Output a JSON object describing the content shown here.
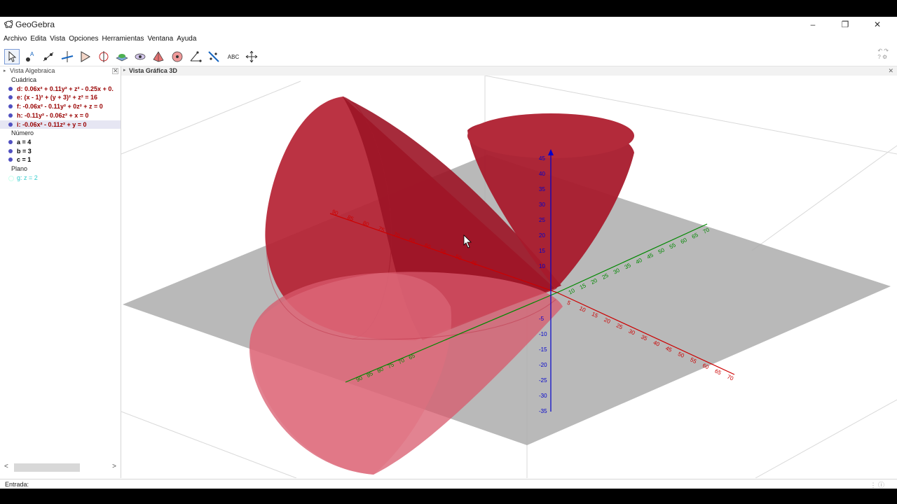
{
  "app": {
    "title": "GeoGebra"
  },
  "window_controls": {
    "minimize": "–",
    "maximize": "❐",
    "close": "✕"
  },
  "menu": [
    "Archivo",
    "Edita",
    "Vista",
    "Opciones",
    "Herramientas",
    "Ventana",
    "Ayuda"
  ],
  "toolbar": {
    "tools": [
      "move-tool",
      "point-tool",
      "line-tool",
      "perpendicular-tool",
      "polygon-tool",
      "circle-axis-tool",
      "intersect-surfaces-tool",
      "plane-tool",
      "pyramid-tool",
      "sphere-tool",
      "angle-tool",
      "reflect-tool",
      "text-tool",
      "move-view-tool"
    ],
    "text_tool_label": "ABC"
  },
  "algebra": {
    "header": "Vista Algebraica",
    "categories": [
      {
        "label": "Cuádrica",
        "items": [
          {
            "text": "d: 0.06x² + 0.11y² + z² - 0.25x + 0.",
            "color": "#990000"
          },
          {
            "text": "e: (x - 1)² + (y + 3)² + z² = 16",
            "color": "#990000"
          },
          {
            "text": "f: -0.06x² - 0.11y² + 0z² + z = 0",
            "color": "#990000"
          },
          {
            "text": "h: -0.11y² - 0.06z² + x = 0",
            "color": "#990000"
          },
          {
            "text": "i: -0.06x² - 0.11z² + y = 0",
            "color": "#990000"
          }
        ]
      },
      {
        "label": "Número",
        "items": [
          {
            "text": "a = 4",
            "color": "#000000"
          },
          {
            "text": "b = 3",
            "color": "#000000"
          },
          {
            "text": "c = 1",
            "color": "#000000"
          }
        ]
      },
      {
        "label": "Plano",
        "items": [
          {
            "text": "g: z = 2",
            "color": "#33cccc"
          }
        ]
      }
    ]
  },
  "view3d": {
    "header": "Vista Gráfica 3D",
    "x_ticks": [
      "5",
      "10",
      "15",
      "20",
      "25",
      "30",
      "35",
      "40",
      "45",
      "50",
      "55",
      "60",
      "65",
      "70"
    ],
    "y_ticks_pos": [
      "10",
      "15",
      "20",
      "25",
      "30",
      "35",
      "40",
      "45",
      "50",
      "55",
      "60",
      "65",
      "70"
    ],
    "y_ticks_neg": [
      "65",
      "70",
      "75",
      "80",
      "85",
      "90"
    ],
    "z_ticks": [
      "-5",
      "-10",
      "-15",
      "-20",
      "-25",
      "-30",
      "-35",
      "10",
      "15",
      "20",
      "25",
      "30",
      "35",
      "40",
      "45"
    ],
    "x_back_ticks": [
      "90",
      "85",
      "80",
      "75",
      "70",
      "65",
      "60",
      "55",
      "50",
      "45"
    ],
    "colors": {
      "surface": "#b0182c",
      "x_axis": "#cc0000",
      "y_axis": "#008800",
      "z_axis": "#0000cc",
      "plane": "#a0a0a0"
    }
  },
  "input": {
    "label": "Entrada:"
  }
}
